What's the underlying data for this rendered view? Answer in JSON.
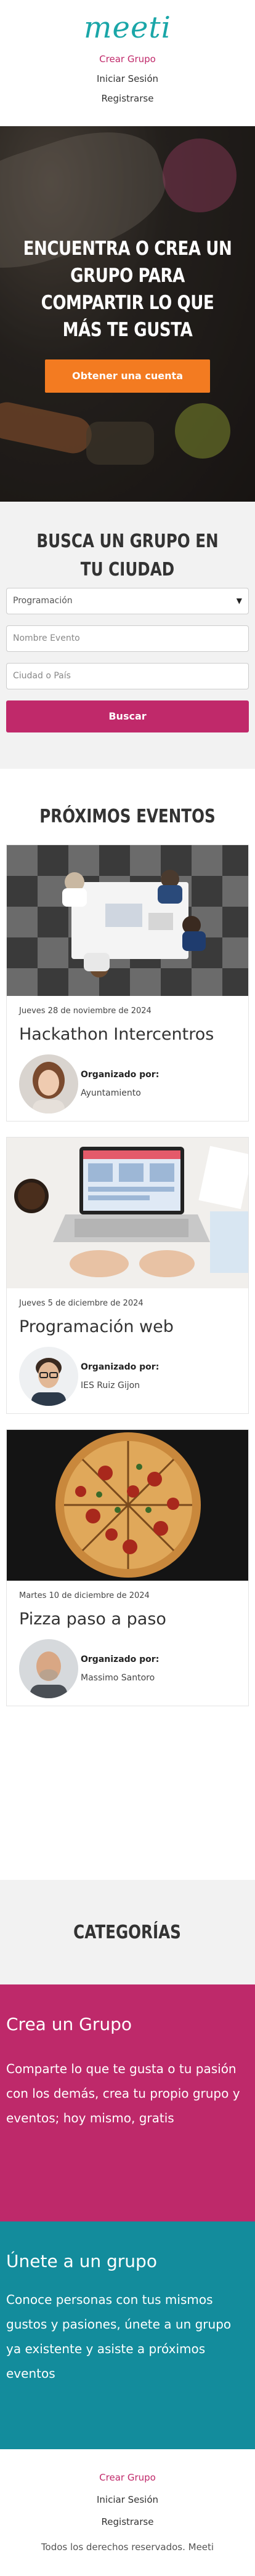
{
  "header": {
    "logo": "meeti",
    "nav": [
      "Crear Grupo",
      "Iniciar Sesión",
      "Registrarse"
    ]
  },
  "hero": {
    "title": "Encuentra o crea un grupo para compartir lo que más te gusta",
    "cta": "Obtener una cuenta"
  },
  "search": {
    "title": "Busca un grupo en tu ciudad",
    "category_selected": "Programación",
    "event_placeholder": "Nombre Evento",
    "city_placeholder": "Ciudad o País",
    "button": "Buscar"
  },
  "events": {
    "title": "Próximos eventos",
    "organizer_label": "Organizado por:",
    "items": [
      {
        "date": "Jueves 28 de noviembre de 2024",
        "title": "Hackathon Intercentros",
        "organizer": "Ayuntamiento"
      },
      {
        "date": "Jueves 5 de diciembre de 2024",
        "title": "Programación web",
        "organizer": "IES Ruiz Gijon"
      },
      {
        "date": "Martes 10 de diciembre de 2024",
        "title": "Pizza paso a paso",
        "organizer": "Massimo Santoro"
      }
    ]
  },
  "categories": {
    "title": "Categorías"
  },
  "create_group": {
    "title": "Crea un Grupo",
    "text": "Comparte lo que te gusta o tu pasión con los demás, crea tu propio grupo y eventos; hoy mismo, gratis"
  },
  "join_group": {
    "title": "Únete a un grupo",
    "text": "Conoce personas con tus mismos gustos y pasiones, únete a un grupo ya existente y asiste a próximos eventos"
  },
  "footer": {
    "nav": [
      "Crear Grupo",
      "Iniciar Sesión",
      "Registrarse"
    ],
    "copyright": "Todos los derechos reservados. Meeti"
  },
  "colors": {
    "brand_teal": "#1aa6a8",
    "accent_pink": "#c0296a",
    "cta_orange": "#f37b21",
    "teal_panel": "#138c9c"
  }
}
